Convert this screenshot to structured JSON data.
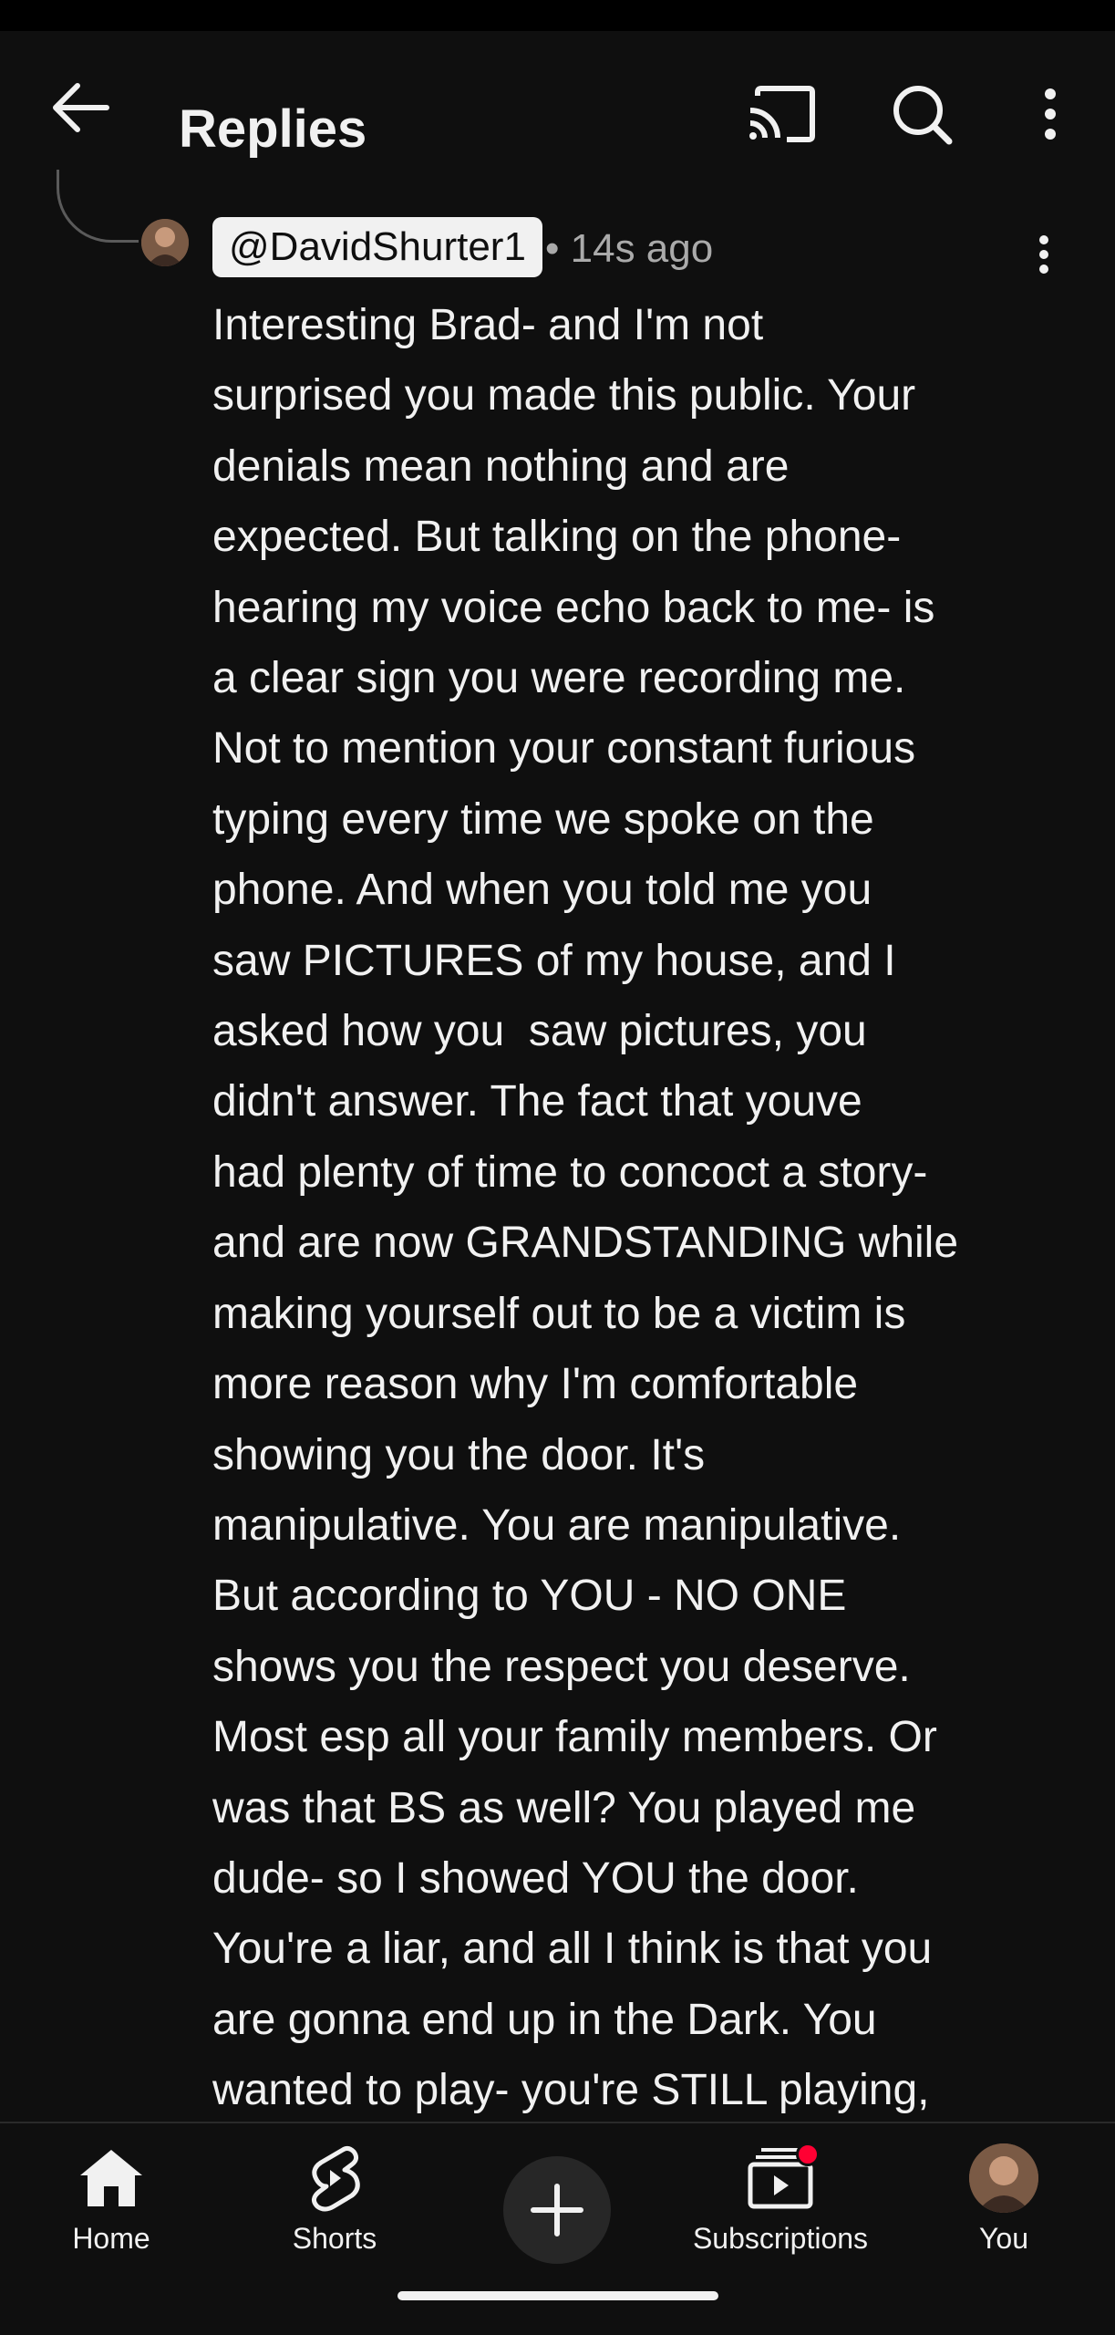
{
  "app_bar": {
    "title": "Replies",
    "icons": [
      "back-arrow-icon",
      "cast-icon",
      "search-icon",
      "more-vertical-icon"
    ]
  },
  "comment": {
    "author": "@DavidShurter1",
    "meta": "• 14s ago",
    "lines": [
      "Interesting Brad- and I'm not",
      "surprised you made this public. Your",
      "denials mean nothing and are",
      "expected. But talking on the phone-",
      "hearing my voice echo back to me- is",
      "a clear sign you were recording me.",
      "Not to mention your constant furious",
      "typing every time we spoke on the",
      "phone. And when you told me you",
      "saw PICTURES of my house, and I",
      "asked how you  saw pictures, you",
      "didn't answer. The fact that youve",
      "had plenty of time to concoct a story-",
      "and are now GRANDSTANDING while",
      "making yourself out to be a victim is",
      "more reason why I'm comfortable",
      "showing you the door. It's",
      "manipulative. You are manipulative.",
      "But according to YOU - NO ONE",
      "shows you the respect you deserve.",
      "Most esp all your family members. Or",
      "was that BS as well? You played me",
      "dude- so I showed YOU the door.",
      "You're a liar, and all I think is that you",
      "are gonna end up in the Dark. You",
      "wanted to play- you're STILL playing,"
    ]
  },
  "bottom_nav": {
    "home": "Home",
    "shorts": "Shorts",
    "subscriptions": "Subscriptions",
    "you": "You"
  },
  "colors": {
    "background": "#0f0f0f",
    "text": "#f1f1f1",
    "secondary_text": "#aaaaaa",
    "notification": "#ff0033"
  }
}
